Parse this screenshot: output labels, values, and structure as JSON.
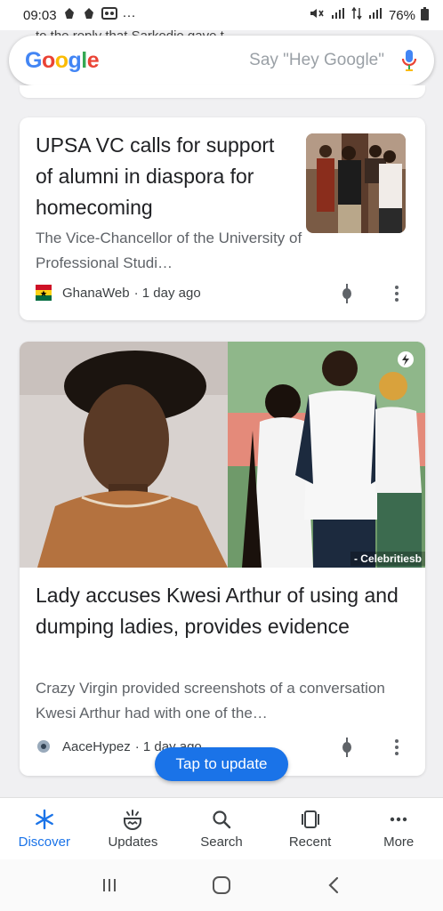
{
  "status_bar": {
    "time": "09:03",
    "extra": "···",
    "battery": "76%"
  },
  "peek_text": "to the reply that Sarkodie gave t",
  "search": {
    "logo": "Google",
    "hint": "Say \"Hey Google\""
  },
  "cards": [
    {
      "title": "UPSA VC calls for support of alumni in diaspora for homecoming",
      "snippet": "The Vice-Chancellor of the University of Professional Studi…",
      "source": "GhanaWeb",
      "age": "· 1 day ago"
    },
    {
      "title": "Lady accuses Kwesi Arthur of using and dumping ladies, provides evidence",
      "snippet": "Crazy Virgin provided screenshots of a conversation Kwesi Arthur had with one of the…",
      "source": "AaceHypez",
      "age": "· 1 day ago",
      "image_credit": "- Celebritiesb"
    }
  ],
  "tap_to_update": "Tap to update",
  "bottom_nav": [
    {
      "label": "Discover",
      "icon": "asterisk-icon",
      "active": true
    },
    {
      "label": "Updates",
      "icon": "updates-icon",
      "active": false
    },
    {
      "label": "Search",
      "icon": "search-icon",
      "active": false
    },
    {
      "label": "Recent",
      "icon": "recent-icon",
      "active": false
    },
    {
      "label": "More",
      "icon": "more-dots-icon",
      "active": false
    }
  ],
  "colors": {
    "accent": "#1a73e8",
    "google_blue": "#4285f4",
    "google_red": "#ea4335",
    "google_yellow": "#fbbc05",
    "google_green": "#34a853"
  }
}
